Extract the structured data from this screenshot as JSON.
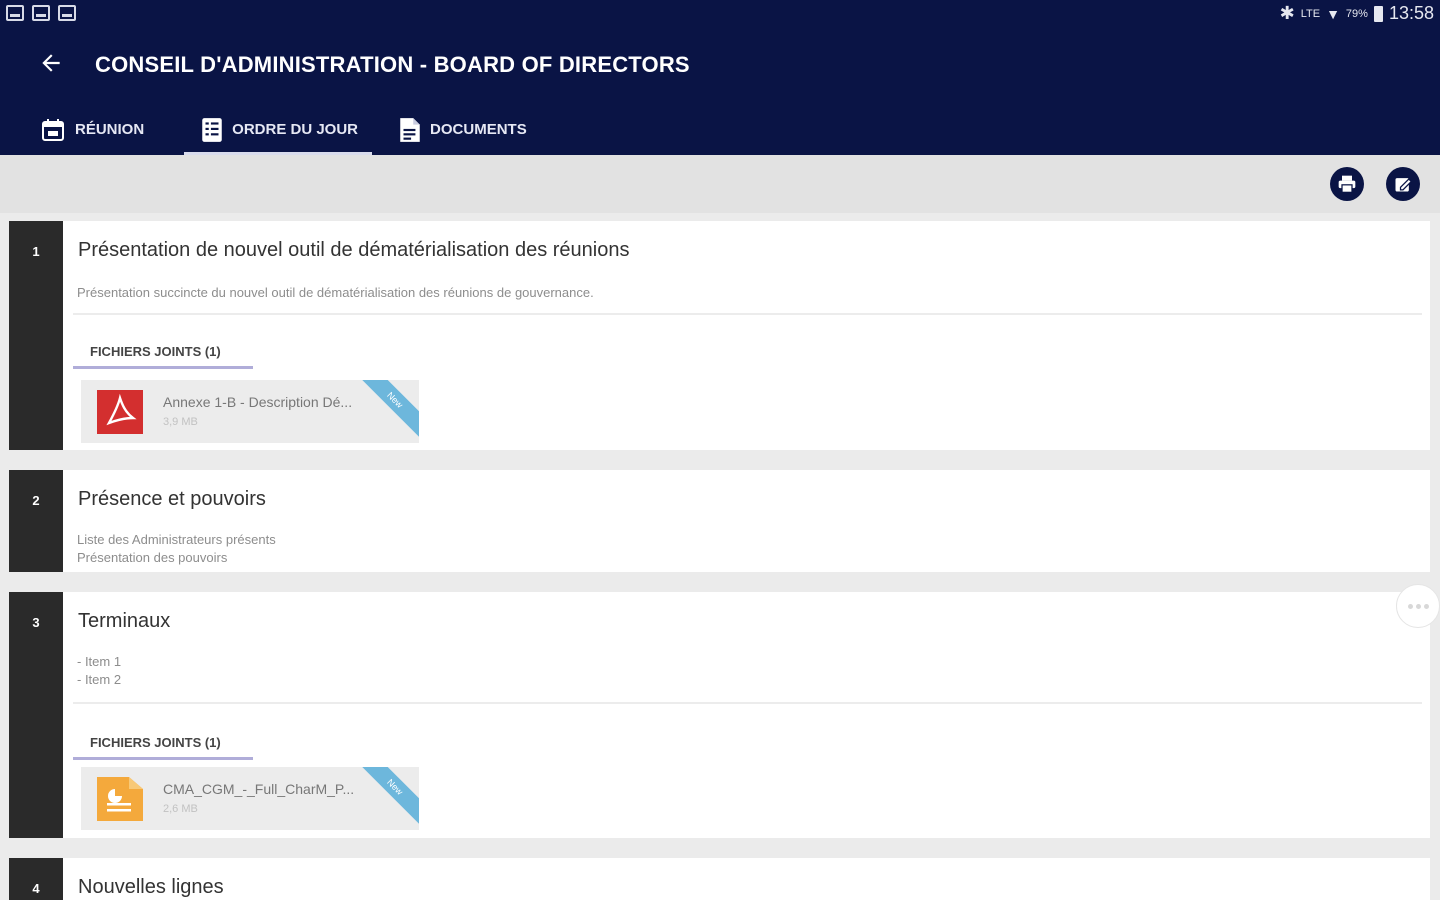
{
  "status_bar": {
    "time": "13:58",
    "battery": "79%",
    "network": "LTE"
  },
  "app": {
    "title": "CONSEIL D'ADMINISTRATION - BOARD OF DIRECTORS"
  },
  "tabs": [
    {
      "label": "RÉUNION",
      "icon": "calendar-icon"
    },
    {
      "label": "ORDRE DU JOUR",
      "icon": "checklist-icon",
      "active": true
    },
    {
      "label": "DOCUMENTS",
      "icon": "document-icon"
    }
  ],
  "toolbar": {
    "icons": [
      "print-icon",
      "edit-calendar-icon"
    ]
  },
  "agenda": [
    {
      "number": "1",
      "title": "Présentation de nouvel outil de dématérialisation des réunions",
      "description": [
        "Présentation succincte du nouvel outil de dématérialisation des réunions de gouvernance."
      ],
      "attachments_label": "FICHIERS JOINTS (1)",
      "file": {
        "name": "Annexe 1-B - Description Dé...",
        "size": "3,9 MB",
        "type": "pdf",
        "ribbon": "New"
      }
    },
    {
      "number": "2",
      "title": "Présence et pouvoirs",
      "description": [
        "Liste des Administrateurs présents",
        "Présentation des pouvoirs"
      ]
    },
    {
      "number": "3",
      "title": "Terminaux",
      "description": [
        "- Item 1",
        "- Item 2"
      ],
      "attachments_label": "FICHIERS JOINTS (1)",
      "file": {
        "name": "CMA_CGM_-_Full_CharM_P...",
        "size": "2,6 MB",
        "type": "slides",
        "ribbon": "New"
      }
    },
    {
      "number": "4",
      "title": "Nouvelles lignes"
    }
  ],
  "colors": {
    "primary": "#0a1445",
    "accent": "#b0add9",
    "ribbon": "#6db7dc",
    "pdf": "#d32f2f",
    "slides": "#f4a93c"
  }
}
